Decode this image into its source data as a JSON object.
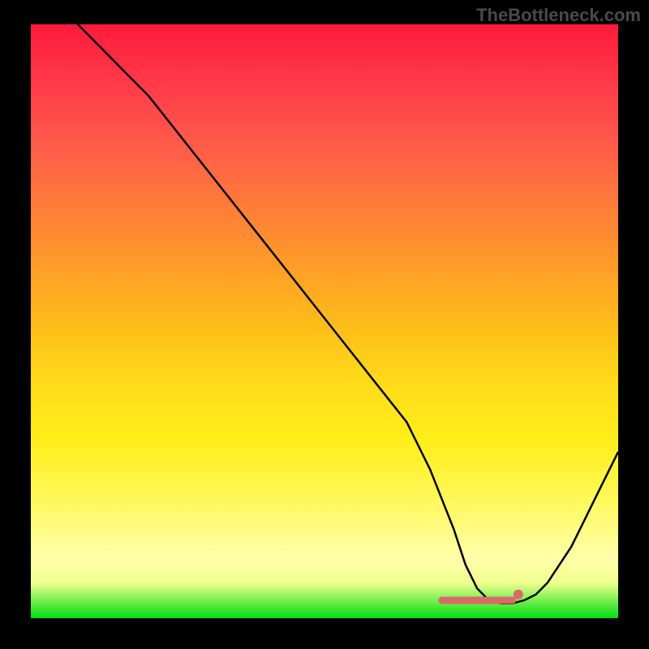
{
  "watermark": "TheBottleneck.com",
  "chart_data": {
    "type": "line",
    "title": "",
    "xlabel": "",
    "ylabel": "",
    "xlim": [
      0,
      100
    ],
    "ylim": [
      0,
      100
    ],
    "x": [
      8,
      12,
      16,
      20,
      24,
      28,
      32,
      36,
      40,
      44,
      48,
      52,
      56,
      60,
      64,
      68,
      70,
      72,
      74,
      76,
      78,
      80,
      82,
      84,
      86,
      88,
      90,
      92,
      94,
      96,
      100
    ],
    "values": [
      100,
      96,
      92,
      88,
      83,
      78,
      73,
      68,
      63,
      58,
      53,
      48,
      43,
      38,
      33,
      25,
      20,
      15,
      9,
      5,
      3,
      2.5,
      2.5,
      3,
      4,
      6,
      9,
      12,
      16,
      20,
      28
    ],
    "marker_segment": {
      "x": [
        70,
        82
      ],
      "y": [
        3,
        3
      ]
    },
    "marker_dot": {
      "x": 83,
      "y": 4
    },
    "marker_color": "#d96a68"
  }
}
